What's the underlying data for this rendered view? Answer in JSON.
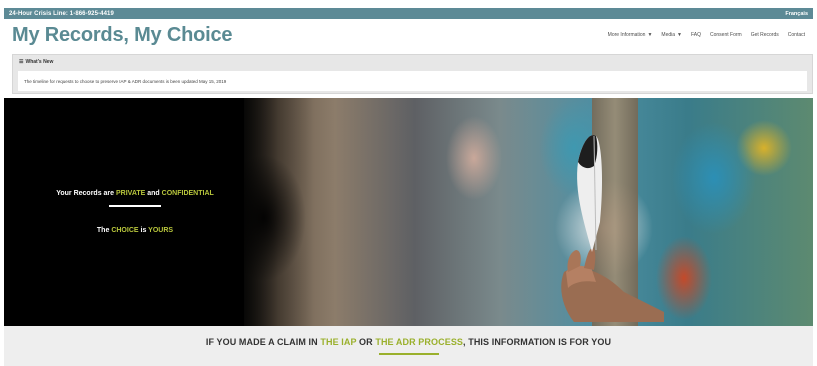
{
  "topbar": {
    "crisis_line": "24-Hour Crisis Line: 1-866-925-4419",
    "language": "Français"
  },
  "header": {
    "logo": "My Records, My Choice",
    "nav": [
      {
        "label": "More Information",
        "dropdown": true
      },
      {
        "label": "Media",
        "dropdown": true
      },
      {
        "label": "FAQ",
        "dropdown": false
      },
      {
        "label": "Consent Form",
        "dropdown": false
      },
      {
        "label": "Get Records",
        "dropdown": false
      },
      {
        "label": "Contact",
        "dropdown": false
      }
    ]
  },
  "whats_new": {
    "heading": "What's New",
    "message": "The timeline for requests to choose to preserve IAP & ADR documents is been updated May 15, 2019"
  },
  "hero": {
    "line1_prefix": "Your Records are",
    "line1_word1": "PRIVATE",
    "line1_and": "and",
    "line1_word2": "CONFIDENTIAL",
    "line2_prefix": "The",
    "line2_word1": "CHOICE",
    "line2_is": "is",
    "line2_word2": "YOURS"
  },
  "banner": {
    "prefix": "IF YOU MADE A CLAIM IN",
    "hl1": "THE IAP",
    "or": "OR",
    "hl2": "THE ADR PROCESS",
    "suffix": ", THIS INFORMATION IS FOR YOU"
  },
  "colors": {
    "topbar": "#5d8a96",
    "logo": "#5a8a93",
    "highlight": "#b8c63c",
    "banner_highlight": "#9ab02c"
  },
  "icons": {
    "dropdown": "caret-down-icon",
    "whats_new": "list-icon"
  }
}
